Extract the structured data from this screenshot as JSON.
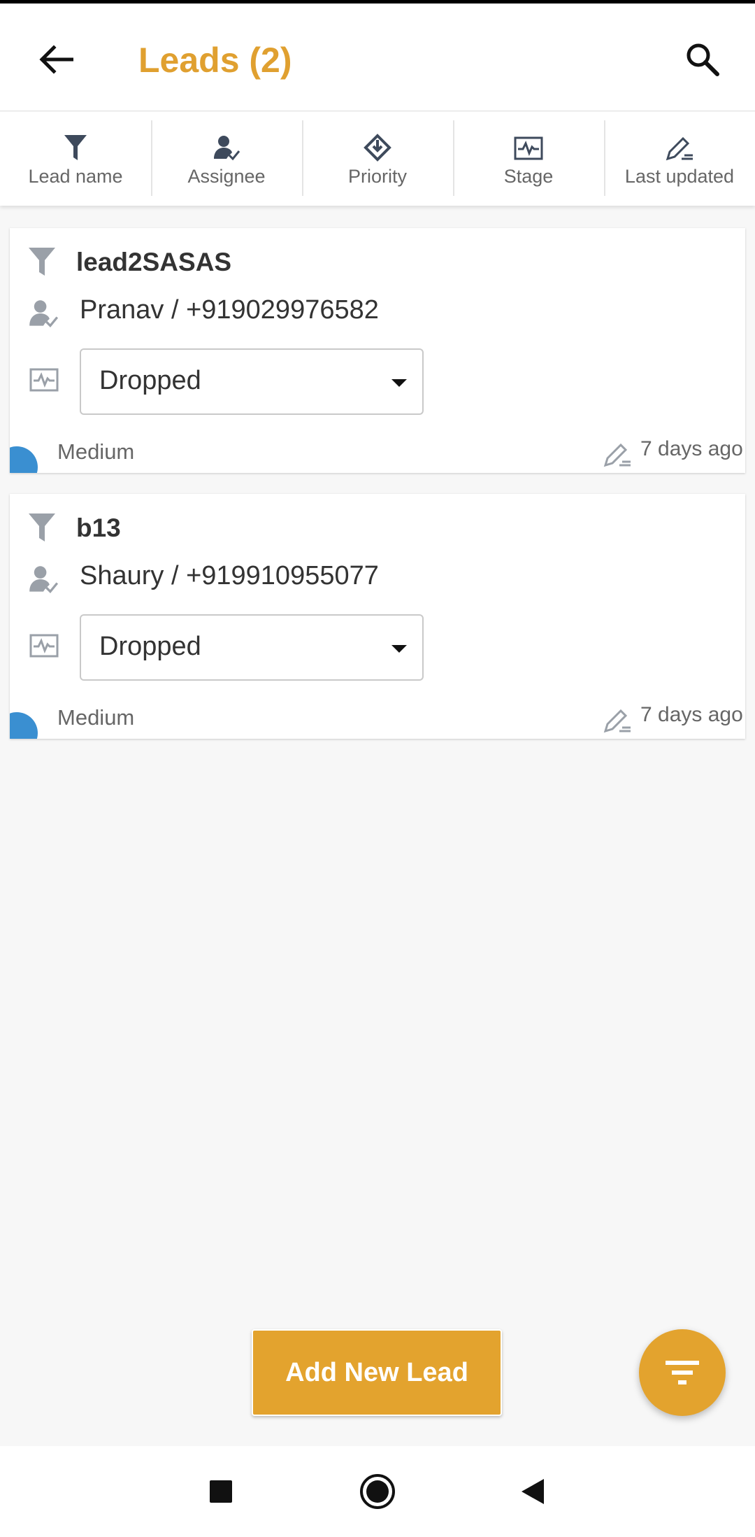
{
  "header": {
    "title": "Leads (2)"
  },
  "sort_options": [
    {
      "label": "Lead name",
      "icon": "funnel-icon"
    },
    {
      "label": "Assignee",
      "icon": "assignee-icon"
    },
    {
      "label": "Priority",
      "icon": "priority-icon"
    },
    {
      "label": "Stage",
      "icon": "stage-icon"
    },
    {
      "label": "Last updated",
      "icon": "edit-icon"
    }
  ],
  "leads": [
    {
      "name": "lead2SASAS",
      "assignee": "Pranav / +919029976582",
      "stage": "Dropped",
      "priority": "Medium",
      "updated": "7 days ago"
    },
    {
      "name": "b13",
      "assignee": "Shaury / +919910955077",
      "stage": "Dropped",
      "priority": "Medium",
      "updated": "7 days ago"
    }
  ],
  "actions": {
    "add_label": "Add New Lead"
  },
  "colors": {
    "accent": "#e3a32e",
    "priority_medium": "#3a8fd1",
    "background": "#f7f7f7"
  }
}
